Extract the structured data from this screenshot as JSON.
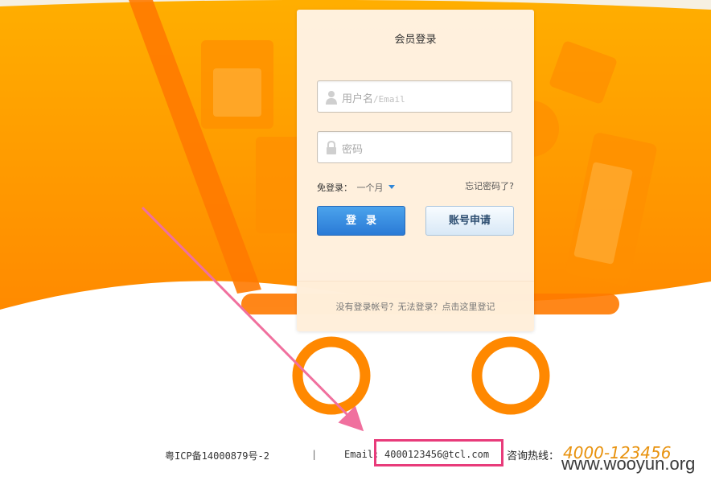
{
  "login": {
    "title": "会员登录",
    "username_placeholder": "用户名",
    "username_placeholder_suffix": "/Email",
    "password_placeholder": "密码",
    "remember_label": "免登录：",
    "remember_value": "一个月",
    "forgot_link": "忘记密码了?",
    "login_button": "登录",
    "apply_button": "账号申请",
    "footer_text": "没有登录帐号？无法登录？点击这里登记"
  },
  "footer": {
    "icp": "粤ICP备14000879号-2",
    "separator": "|",
    "email_label": "Email:",
    "email_value": "4000123456@tcl.com",
    "hotline_label": "咨询热线：",
    "hotline_number": "4000-123456"
  },
  "watermark": "www.wooyun.org",
  "colors": {
    "orange": "#ff9e00",
    "wheel": "#ff8800",
    "login_blue": "#2a7ad6",
    "highlight_pink": "#e83b7a",
    "hotline_orange": "#e8920e"
  }
}
